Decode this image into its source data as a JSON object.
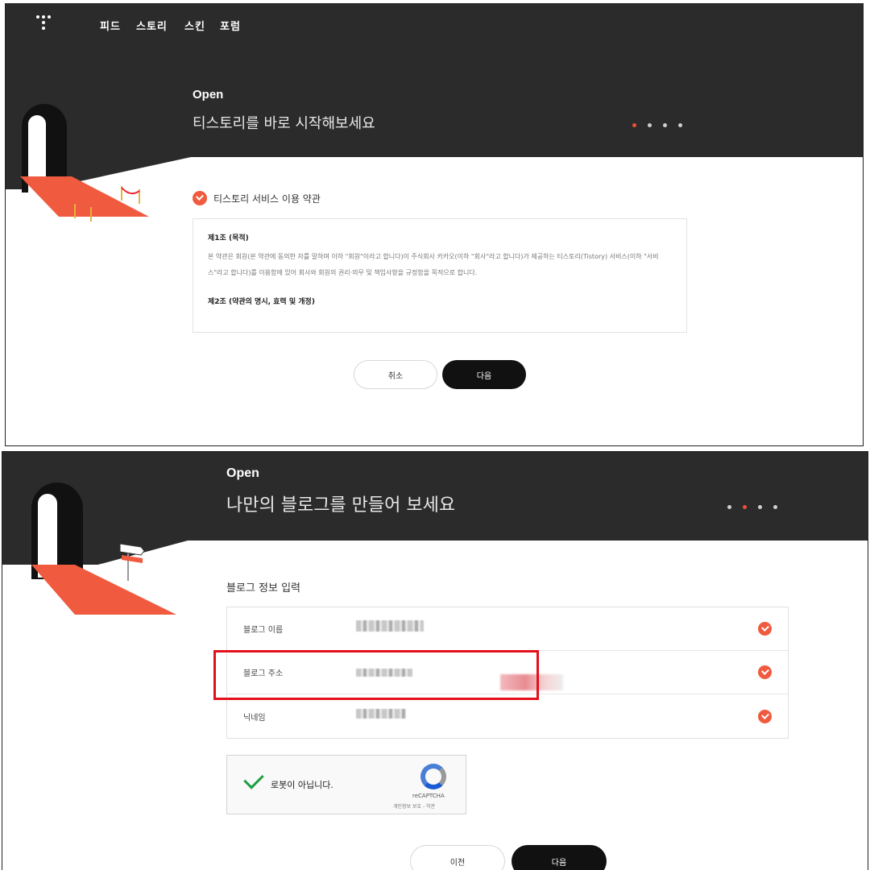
{
  "panel1": {
    "nav": [
      "피드",
      "스토리",
      "스킨",
      "포럼"
    ],
    "open_label": "Open",
    "headline": "티스토리를 바로 시작해보세요",
    "terms_title": "티스토리 서비스 이용 약관",
    "article1_title": "제1조 (목적)",
    "article1_text": "본 약관은 회원(본 약관에 동의한 자를 말하며 이하 \"회원\"이라고 합니다)이 주식회사 카카오(이하 \"회사\"라고 합니다)가 제공하는 티스토리(Tistory) 서비스(이하 \"서비스\"라고 합니다)를 이용함에 있어 회사와 회원의 권리·의무 및 책임사항을 규정함을 목적으로 합니다.",
    "article2_title": "제2조 (약관의 명시, 효력 및 개정)",
    "cancel_label": "취소",
    "next_label": "다음",
    "active_step": 1
  },
  "panel2": {
    "open_label": "Open",
    "headline": "나만의 블로그를 만들어 보세요",
    "section_title": "블로그 정보 입력",
    "rows": [
      {
        "label": "블로그 이름"
      },
      {
        "label": "블로그 주소"
      },
      {
        "label": "닉네임"
      }
    ],
    "recaptcha_label": "로봇이 아닙니다.",
    "recaptcha_brand": "reCAPTCHA",
    "recaptcha_links": "개인정보 보호 - 약관",
    "prev_label": "이전",
    "next_label": "다음",
    "active_step": 2
  },
  "colors": {
    "accent": "#f05a3e",
    "dark_bg": "#2b2b2b",
    "highlight": "#e3101c"
  }
}
